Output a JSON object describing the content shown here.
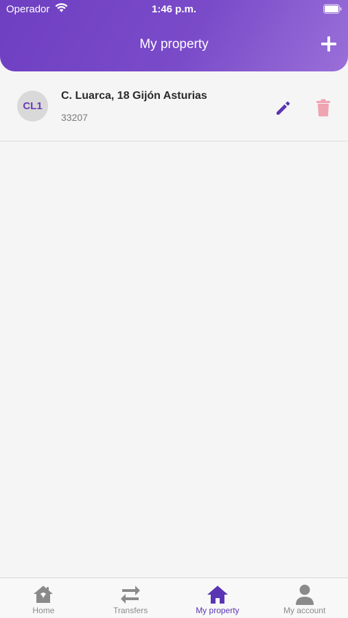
{
  "status_bar": {
    "carrier": "Operador",
    "time": "1:46 p.m."
  },
  "header": {
    "title": "My property",
    "add_icon": "plus-icon"
  },
  "properties": [
    {
      "initials": "CL1",
      "address": "C. Luarca, 18 Gijón Asturias",
      "postal_code": "33207",
      "edit_icon": "pencil-icon",
      "delete_icon": "trash-icon"
    }
  ],
  "tabbar": {
    "tabs": [
      {
        "label": "Home",
        "icon": "home-icon",
        "active": false
      },
      {
        "label": "Transfers",
        "icon": "transfer-arrows-icon",
        "active": false
      },
      {
        "label": "My property",
        "icon": "house-icon",
        "active": true
      },
      {
        "label": "My account",
        "icon": "user-icon",
        "active": false
      }
    ]
  },
  "colors": {
    "accent": "#5a35b3",
    "header_gradient_start": "#6e3fc1",
    "header_gradient_end": "#9a6fd8",
    "delete": "#f0a3b0",
    "inactive_tab": "#8a8a8a"
  }
}
